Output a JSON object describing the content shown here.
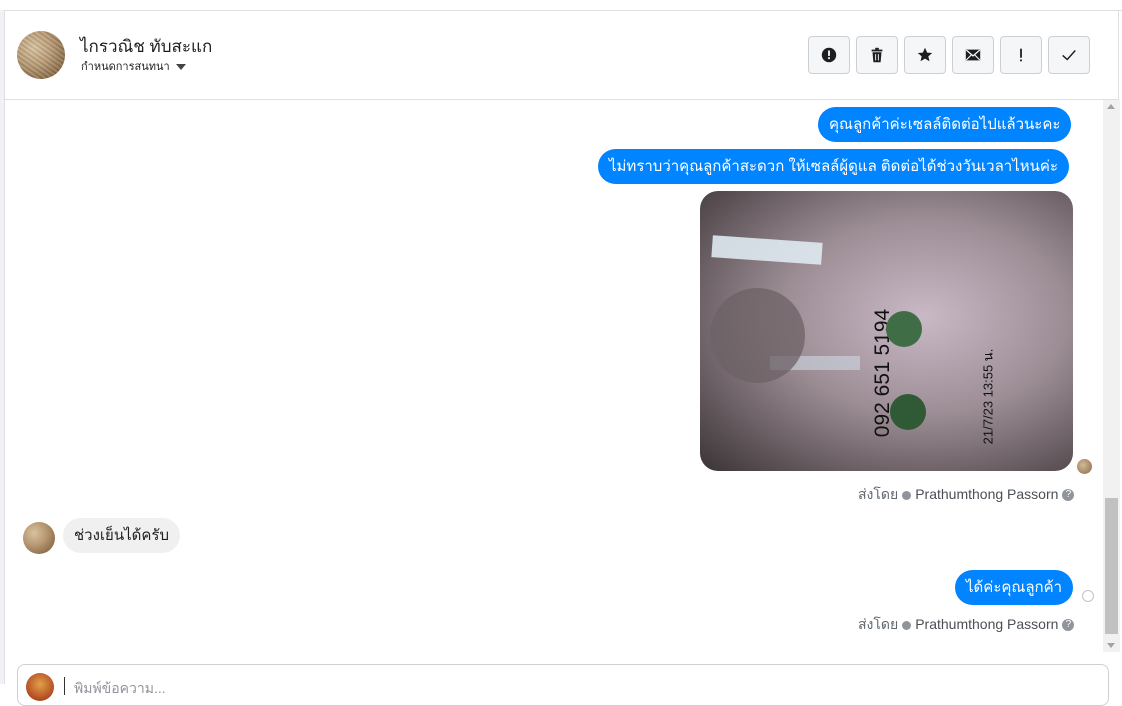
{
  "header": {
    "contact_name": "ไกรวณิช ทับสะแก",
    "subtitle": "กำหนดการสนทนา",
    "actions": [
      {
        "icon": "alert-circle-icon",
        "name": "mark-spam-button"
      },
      {
        "icon": "trash-icon",
        "name": "delete-button"
      },
      {
        "icon": "star-icon",
        "name": "star-button"
      },
      {
        "icon": "envelope-icon",
        "name": "mark-unread-button"
      },
      {
        "icon": "exclamation-icon",
        "name": "priority-button"
      },
      {
        "icon": "check-icon",
        "name": "done-button"
      }
    ]
  },
  "messages": {
    "out1": "คุณลูกค้าค่ะเซลล์ติดต่อไปแล้วนะคะ",
    "out2": "ไม่ทราบว่าคุณลูกค้าสะดวก ให้เซลล์ผู้ดูแล ติดต่อได้ช่วงวันเวลาไหนค่ะ",
    "photo_phone": "092 651 5194",
    "photo_date": "21/7/23 13:55 น.",
    "sent_by_label": "ส่งโดย",
    "sender_name": "Prathumthong Passorn",
    "in1": "ช่วงเย็นได้ครับ",
    "out3": "ได้ค่ะคุณลูกค้า"
  },
  "composer": {
    "placeholder": "พิมพ์ข้อความ..."
  },
  "colors": {
    "bubble_out": "#0084ff",
    "bubble_in": "#f1f0f0"
  }
}
